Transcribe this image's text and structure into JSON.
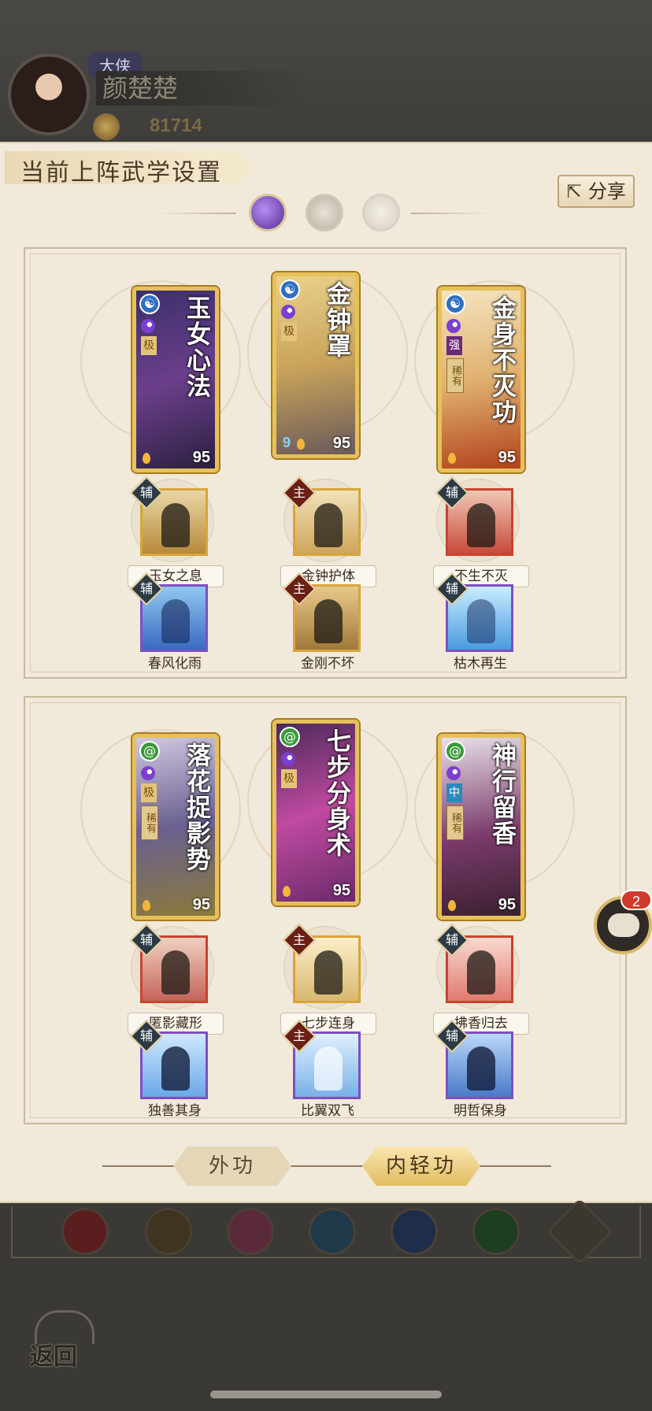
{
  "player": {
    "title": "大侠",
    "name": "颜楚楚",
    "power": "81714"
  },
  "panel": {
    "title": "当前上阵武学设置",
    "share_label": "分享",
    "modes": [
      {
        "icon": "moon-orb-icon",
        "active": true
      },
      {
        "icon": "sun-orb-icon",
        "active": false
      },
      {
        "icon": "crescent-orb-icon",
        "active": false
      }
    ]
  },
  "sections": [
    {
      "cards": [
        {
          "name": "玉女心法",
          "school_icon": "yin-yang-icon",
          "grade": "极",
          "rare": "",
          "level": "95"
        },
        {
          "name": "金钟罩",
          "school_icon": "yin-yang-icon",
          "grade": "极",
          "rare": "",
          "level": "95",
          "count": "9"
        },
        {
          "name": "金身不灭功",
          "school_icon": "yin-yang-icon",
          "grade": "强",
          "rare": "稀有",
          "level": "95"
        }
      ],
      "skills_row1": [
        {
          "tag": "辅",
          "label": "玉女之息"
        },
        {
          "tag": "主",
          "label": "金钟护体"
        },
        {
          "tag": "辅",
          "label": "不生不灭"
        }
      ],
      "skills_row2": [
        {
          "tag": "辅",
          "label": "春风化雨"
        },
        {
          "tag": "主",
          "label": "金刚不坏"
        },
        {
          "tag": "辅",
          "label": "枯木再生"
        }
      ]
    },
    {
      "cards": [
        {
          "name": "落花捉影势",
          "school_icon": "swirl-icon",
          "grade": "极",
          "rare": "稀有",
          "level": "95"
        },
        {
          "name": "七步分身术",
          "school_icon": "swirl-icon",
          "grade": "极",
          "rare": "",
          "level": "95"
        },
        {
          "name": "神行留香",
          "school_icon": "swirl-icon",
          "grade": "中",
          "rare": "稀有",
          "level": "95"
        }
      ],
      "skills_row1": [
        {
          "tag": "辅",
          "label": "匿影藏形"
        },
        {
          "tag": "主",
          "label": "七步连身"
        },
        {
          "tag": "辅",
          "label": "拂香归去"
        }
      ],
      "skills_row2": [
        {
          "tag": "辅",
          "label": "独善其身"
        },
        {
          "tag": "主",
          "label": "比翼双飞"
        },
        {
          "tag": "辅",
          "label": "明哲保身"
        }
      ]
    }
  ],
  "tabs": {
    "outer": "外功",
    "inner": "内轻功",
    "active": "inner"
  },
  "chat": {
    "badge": "2"
  },
  "back_label": "返回",
  "bottom_icons": [
    "sword-icon",
    "spear-icon",
    "fist-icon",
    "fan-icon",
    "yin-yang-icon",
    "swirl-icon",
    "chevron-up-icon"
  ],
  "colors": {
    "panel_bg": "#f1e9da",
    "card_gold": "#e6c15a",
    "tab_active": "#e2bd62",
    "badge_red": "#d0392b"
  }
}
